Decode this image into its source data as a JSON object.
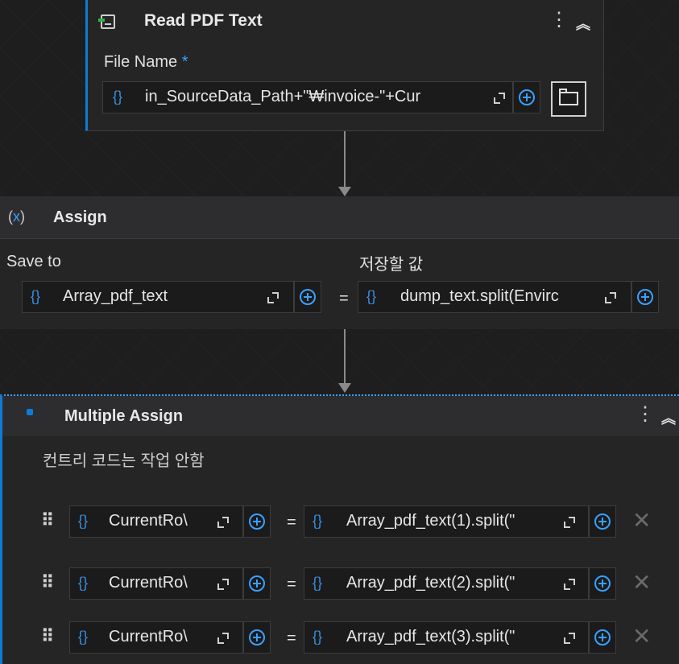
{
  "read_pdf": {
    "title": "Read PDF Text",
    "file_label": "File Name",
    "required_mark": "*",
    "file_value": "in_SourceData_Path+\"₩invoice-\"+Cur"
  },
  "assign": {
    "title": "Assign",
    "icon_text": "(x)",
    "save_to_label": "Save to",
    "value_label": "저장할 값",
    "save_to_value": "Array_pdf_text",
    "value_value": "dump_text.split(Envirc",
    "equals": "="
  },
  "multiple_assign": {
    "title": "Multiple Assign",
    "annotation": "컨트리 코드는 작업 안함",
    "rows": [
      {
        "left": "CurrentRo\\",
        "right": "Array_pdf_text(1).split(\""
      },
      {
        "left": "CurrentRo\\",
        "right": "Array_pdf_text(2).split(\""
      },
      {
        "left": "CurrentRo\\",
        "right": "Array_pdf_text(3).split(\""
      }
    ]
  },
  "glyphs": {
    "brace": "{}",
    "kebab": "⋮",
    "collapse": "⌃⌃",
    "drag": "⠿",
    "delete": "✕"
  },
  "colors": {
    "accent": "#3aa0ff",
    "panel": "#252526",
    "background": "#1e1e1e"
  }
}
